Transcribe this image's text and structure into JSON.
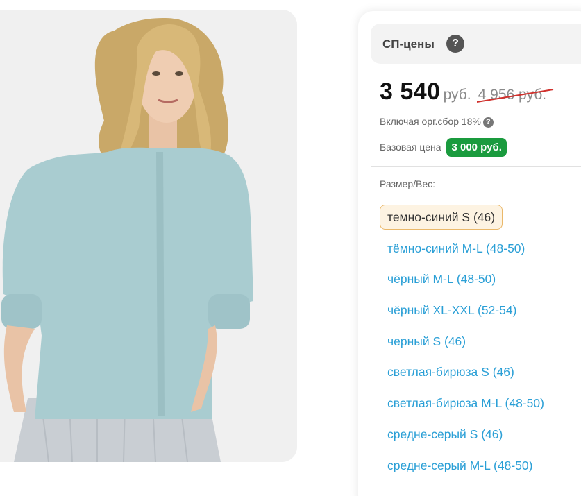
{
  "product": {
    "image_description": "product-photo"
  },
  "pricing": {
    "header_title": "СП-цены",
    "header_help_icon": "question-circle-icon",
    "price": "3 540",
    "currency": "руб.",
    "old_price": "4 956 руб.",
    "including_text": "Включая орг.сбор 18%",
    "including_help_icon": "question-circle-icon",
    "base_label": "Базовая цена",
    "base_price": "3 000 руб.",
    "accent_color": "#1a9b3e",
    "link_color": "#2a9fd6"
  },
  "sizes": {
    "label": "Размер/Вес:",
    "selected_index": 0,
    "items": [
      {
        "label": "темно-синий S (46)"
      },
      {
        "label": "тёмно-синий M-L (48-50)"
      },
      {
        "label": "чёрный M-L (48-50)"
      },
      {
        "label": "чёрный XL-XXL (52-54)"
      },
      {
        "label": "черный S (46)"
      },
      {
        "label": "светлая-бирюза S (46)"
      },
      {
        "label": "светлая-бирюза M-L (48-50)"
      },
      {
        "label": "средне-серый S (46)"
      },
      {
        "label": "средне-серый M-L (48-50)"
      }
    ]
  }
}
